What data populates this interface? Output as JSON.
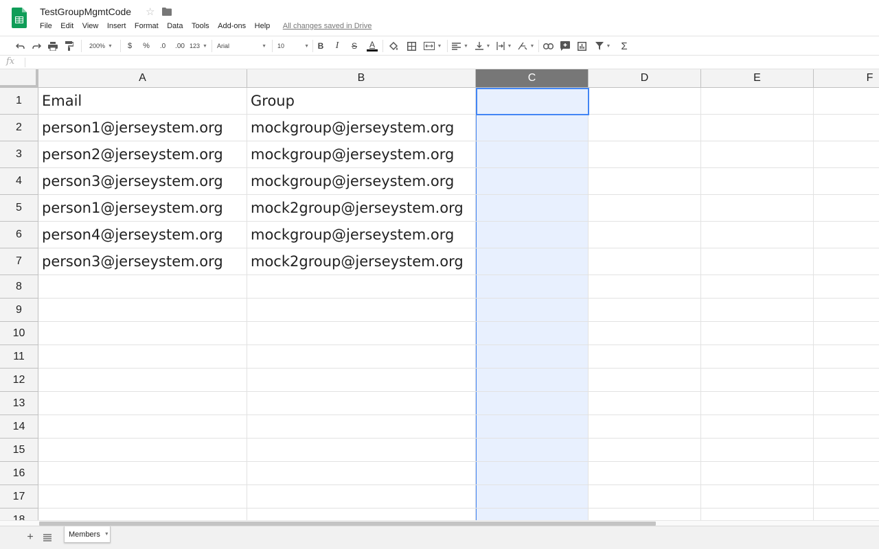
{
  "app": {
    "title": "TestGroupMgmtCode",
    "save_status": "All changes saved in Drive",
    "accent_color": "#0f9d58",
    "menu": [
      "File",
      "Edit",
      "View",
      "Insert",
      "Format",
      "Data",
      "Tools",
      "Add-ons",
      "Help"
    ]
  },
  "toolbar": {
    "zoom": "200%",
    "currency": "$",
    "percent": "%",
    "decrease_decimal": ".0",
    "increase_decimal": ".00",
    "more_formats": "123",
    "font": "Arial",
    "font_size": "10",
    "bold": "B",
    "italic": "I",
    "strikethrough": "S",
    "text_color": "A",
    "sum": "Σ"
  },
  "formula_bar": {
    "fx_label": "fx",
    "value": ""
  },
  "grid": {
    "columns": [
      "A",
      "B",
      "C",
      "D",
      "E",
      "F"
    ],
    "selected_column": "C",
    "active_cell": "C1",
    "row_numbers": [
      "1",
      "2",
      "3",
      "4",
      "5",
      "6",
      "7",
      "8",
      "9",
      "10",
      "11",
      "12",
      "13",
      "14",
      "15",
      "16",
      "17",
      "18"
    ],
    "rows": [
      [
        "Email",
        "Group"
      ],
      [
        "person1@jerseystem.org",
        "mockgroup@jerseystem.org"
      ],
      [
        "person2@jerseystem.org",
        "mockgroup@jerseystem.org"
      ],
      [
        "person3@jerseystem.org",
        "mockgroup@jerseystem.org"
      ],
      [
        "person1@jerseystem.org",
        "mock2group@jerseystem.org"
      ],
      [
        "person4@jerseystem.org",
        "mockgroup@jerseystem.org"
      ],
      [
        "person3@jerseystem.org",
        "mock2group@jerseystem.org"
      ]
    ]
  },
  "sheets": {
    "add_label": "+",
    "tabs": [
      {
        "label": "Members",
        "active": true
      }
    ]
  }
}
